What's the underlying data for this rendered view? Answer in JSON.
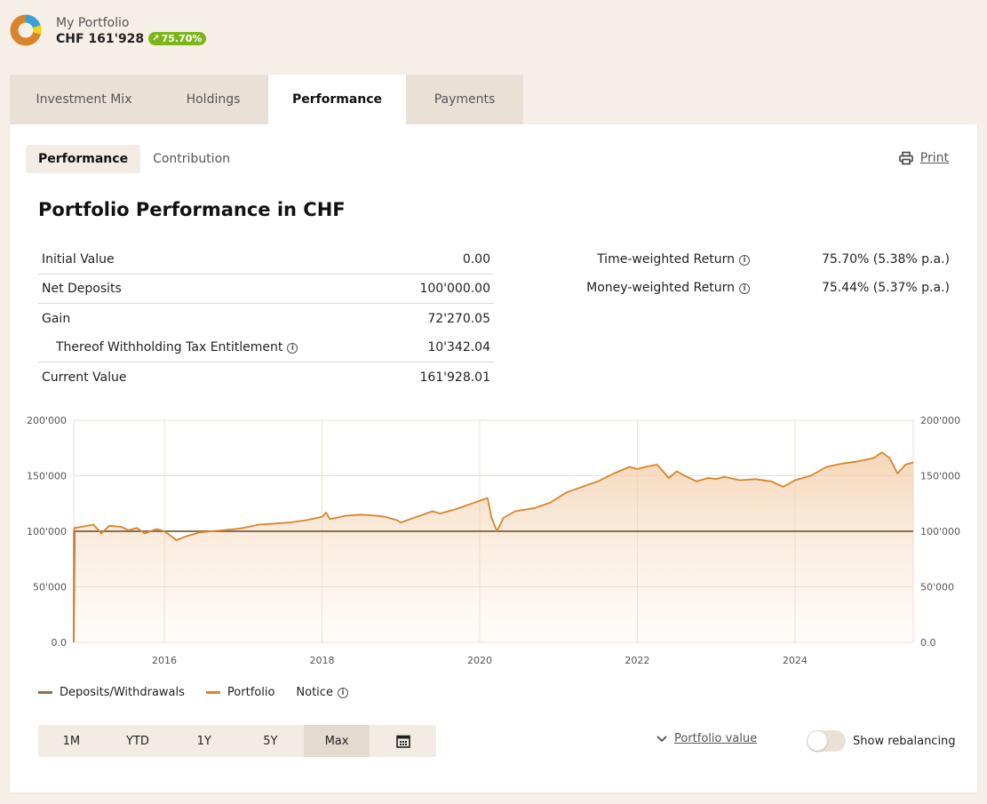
{
  "header": {
    "title": "My Portfolio",
    "value": "CHF 161'928",
    "gain_badge": "75.70%"
  },
  "tabs": [
    {
      "label": "Investment Mix"
    },
    {
      "label": "Holdings"
    },
    {
      "label": "Performance"
    },
    {
      "label": "Payments"
    }
  ],
  "subtabs": [
    {
      "label": "Performance"
    },
    {
      "label": "Contribution"
    }
  ],
  "print_label": "Print",
  "section_title": "Portfolio Performance in CHF",
  "summary": [
    {
      "label": "Initial Value",
      "value": "0.00"
    },
    {
      "label": "Net Deposits",
      "value": "100'000.00"
    },
    {
      "label": "Gain",
      "value": "72'270.05"
    },
    {
      "label": "Thereof Withholding Tax Entitlement",
      "value": "10'342.04"
    },
    {
      "label": "Current Value",
      "value": "161'928.01"
    }
  ],
  "returns": [
    {
      "label": "Time-weighted Return",
      "value": "75.70% (5.38% p.a.)"
    },
    {
      "label": "Money-weighted Return",
      "value": "75.44% (5.37% p.a.)"
    }
  ],
  "legend": {
    "deposits": "Deposits/Withdrawals",
    "portfolio": "Portfolio",
    "notice": "Notice"
  },
  "periods": [
    {
      "label": "1M"
    },
    {
      "label": "YTD"
    },
    {
      "label": "1Y"
    },
    {
      "label": "5Y"
    },
    {
      "label": "Max"
    }
  ],
  "portfolio_value_label": "Portfolio value",
  "rebalancing_label": "Show rebalancing",
  "colors": {
    "accent": "#d9842b",
    "deposits_line": "#8a6f52",
    "badge": "#7cb518"
  },
  "chart_data": {
    "type": "area",
    "x_ticks": [
      "2016",
      "2018",
      "2020",
      "2022",
      "2024"
    ],
    "y_ticks": [
      "0.0",
      "50'000",
      "100'000",
      "150'000",
      "200'000"
    ],
    "ylim": [
      0,
      200000
    ],
    "xlim": [
      2014.85,
      2025.5
    ],
    "grid": true,
    "legend_position": "bottom-left",
    "series": [
      {
        "name": "Deposits/Withdrawals",
        "x": [
          2014.85,
          2014.86,
          2025.5
        ],
        "values": [
          0,
          100000,
          100000
        ]
      },
      {
        "name": "Portfolio",
        "x": [
          2014.85,
          2014.86,
          2014.95,
          2015.1,
          2015.2,
          2015.3,
          2015.45,
          2015.55,
          2015.65,
          2015.75,
          2015.9,
          2016.0,
          2016.1,
          2016.15,
          2016.3,
          2016.45,
          2016.6,
          2016.75,
          2016.9,
          2017.0,
          2017.2,
          2017.4,
          2017.6,
          2017.8,
          2018.0,
          2018.05,
          2018.1,
          2018.3,
          2018.5,
          2018.7,
          2018.8,
          2018.95,
          2019.0,
          2019.2,
          2019.4,
          2019.5,
          2019.7,
          2019.9,
          2020.1,
          2020.15,
          2020.22,
          2020.3,
          2020.45,
          2020.7,
          2020.9,
          2021.1,
          2021.3,
          2021.5,
          2021.7,
          2021.9,
          2022.0,
          2022.1,
          2022.25,
          2022.4,
          2022.5,
          2022.6,
          2022.75,
          2022.9,
          2023.0,
          2023.1,
          2023.3,
          2023.5,
          2023.7,
          2023.85,
          2024.0,
          2024.2,
          2024.4,
          2024.6,
          2024.8,
          2025.0,
          2025.1,
          2025.2,
          2025.3,
          2025.4,
          2025.5
        ],
        "values": [
          100000,
          103000,
          104000,
          106000,
          98000,
          105000,
          104000,
          101000,
          103000,
          98000,
          102000,
          100000,
          95000,
          92000,
          96000,
          99000,
          100000,
          101000,
          102000,
          103000,
          106000,
          107000,
          108000,
          110000,
          113000,
          117000,
          111000,
          114000,
          115000,
          114000,
          113000,
          110000,
          108000,
          113000,
          118000,
          116000,
          120000,
          125000,
          130000,
          112000,
          100000,
          112000,
          118000,
          121000,
          126000,
          135000,
          140000,
          145000,
          152000,
          158000,
          156000,
          158000,
          160000,
          148000,
          154000,
          150000,
          145000,
          148000,
          147000,
          149000,
          146000,
          147000,
          145000,
          140000,
          146000,
          150000,
          158000,
          161000,
          163000,
          166000,
          171000,
          166000,
          152000,
          160000,
          162000
        ]
      }
    ]
  }
}
